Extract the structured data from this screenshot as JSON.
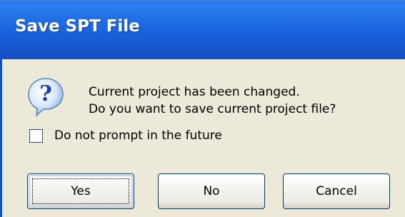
{
  "dialog": {
    "title": "Save SPT File",
    "message_line1": "Current project has been changed.",
    "message_line2": "Do you want to save current project file?",
    "checkbox_label": "Do not prompt in the future",
    "checkbox_checked": false,
    "icon": "question-icon",
    "buttons": {
      "yes": "Yes",
      "no": "No",
      "cancel": "Cancel"
    },
    "colors": {
      "titlebar": "#1863dd",
      "background": "#ece9d8"
    }
  }
}
